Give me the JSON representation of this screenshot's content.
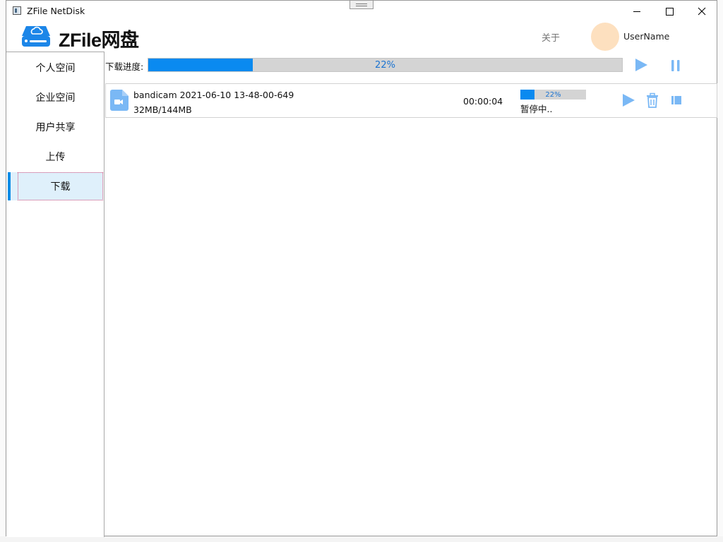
{
  "window": {
    "title": "ZFile NetDisk"
  },
  "header": {
    "brand": "ZFile网盘",
    "about": "关于",
    "username": "UserName"
  },
  "sidebar": {
    "items": [
      {
        "label": "个人空间"
      },
      {
        "label": "企业空间"
      },
      {
        "label": "用户共享"
      },
      {
        "label": "上传"
      },
      {
        "label": "下载"
      }
    ],
    "active": "下载"
  },
  "download": {
    "label": "下载进度:",
    "progress": 22,
    "progress_text": "22%"
  },
  "files": [
    {
      "name": "bandicam 2021-06-10 13-48-00-649",
      "size": "32MB/144MB",
      "time": "00:00:04",
      "progress": 22,
      "progress_text": "22%",
      "status": "暂停中.."
    }
  ],
  "colors": {
    "accent": "#0a8af0",
    "icon_light": "#7ab8f5",
    "avatar": "#fde0bf",
    "active_bg": "#dff0fb"
  }
}
